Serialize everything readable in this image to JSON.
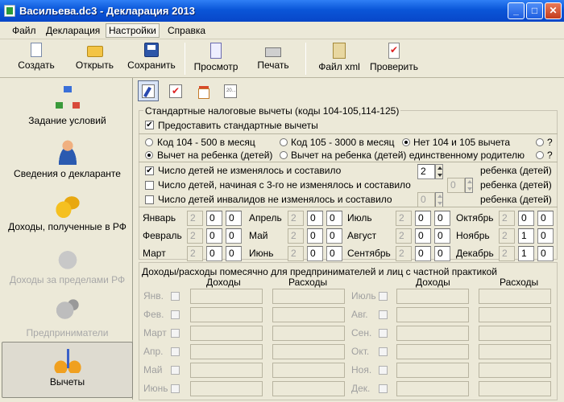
{
  "window": {
    "title": "Васильева.dc3 - Декларация 2013",
    "min": "_",
    "max": "□",
    "close": "✕"
  },
  "menu": {
    "items": [
      "Файл",
      "Декларация",
      "Настройки",
      "Справка"
    ]
  },
  "toolbar": {
    "items": [
      "Создать",
      "Открыть",
      "Сохранить",
      "Просмотр",
      "Печать",
      "Файл xml",
      "Проверить"
    ]
  },
  "sidebar": {
    "items": [
      {
        "label": "Задание условий",
        "icon": "tree-icon"
      },
      {
        "label": "Сведения о декларанте",
        "icon": "person-icon"
      },
      {
        "label": "Доходы, полученные в РФ",
        "icon": "coins-icon"
      },
      {
        "label": "Доходы за пределами РФ",
        "icon": "moneybag-icon",
        "disabled": true
      },
      {
        "label": "Предприниматели",
        "icon": "businessman-icon",
        "disabled": true
      },
      {
        "label": "Вычеты",
        "icon": "scales-icon",
        "selected": true
      }
    ]
  },
  "deductions": {
    "group_title": "Стандартные налоговые вычеты (коды 104-105,114-125)",
    "provide_label": "Предоставить стандартные вычеты",
    "radio_row1": [
      "Код 104 - 500 в месяц",
      "Код 105 - 3000 в месяц",
      "Нет 104 и 105 вычета",
      "?"
    ],
    "radio_row2": [
      "Вычет на ребенка (детей)",
      "Вычет на ребенка (детей) единственному родителю",
      "?"
    ],
    "children_rows": [
      {
        "label": "Число детей не изменялось и составило",
        "value": "2",
        "suffix": "ребенка (детей)"
      },
      {
        "label": "Число детей, начиная с 3-го не изменялось и составило",
        "value": "0",
        "suffix": "ребенка (детей)"
      },
      {
        "label": "Число детей инвалидов не изменялось и составило",
        "value": "0",
        "suffix": "ребенка (детей)"
      }
    ],
    "months": [
      {
        "name": "Январь",
        "a": "2",
        "b": "0",
        "c": "0"
      },
      {
        "name": "Февраль",
        "a": "2",
        "b": "0",
        "c": "0"
      },
      {
        "name": "Март",
        "a": "2",
        "b": "0",
        "c": "0"
      },
      {
        "name": "Апрель",
        "a": "2",
        "b": "0",
        "c": "0"
      },
      {
        "name": "Май",
        "a": "2",
        "b": "0",
        "c": "0"
      },
      {
        "name": "Июнь",
        "a": "2",
        "b": "0",
        "c": "0"
      },
      {
        "name": "Июль",
        "a": "2",
        "b": "0",
        "c": "0"
      },
      {
        "name": "Август",
        "a": "2",
        "b": "0",
        "c": "0"
      },
      {
        "name": "Сентябрь",
        "a": "2",
        "b": "0",
        "c": "0"
      },
      {
        "name": "Октябрь",
        "a": "2",
        "b": "0",
        "c": "0"
      },
      {
        "name": "Ноябрь",
        "a": "2",
        "b": "1",
        "c": "0"
      },
      {
        "name": "Декабрь",
        "a": "2",
        "b": "1",
        "c": "0"
      }
    ]
  },
  "entrepreneur": {
    "title": "Доходы/расходы помесячно для предпринимателей и лиц с частной практикой",
    "col_income": "Доходы",
    "col_expense": "Расходы",
    "left_months": [
      "Янв.",
      "Фев.",
      "Март",
      "Апр.",
      "Май",
      "Июнь"
    ],
    "right_months": [
      "Июль",
      "Авг.",
      "Сен.",
      "Окт.",
      "Ноя.",
      "Дек."
    ]
  }
}
